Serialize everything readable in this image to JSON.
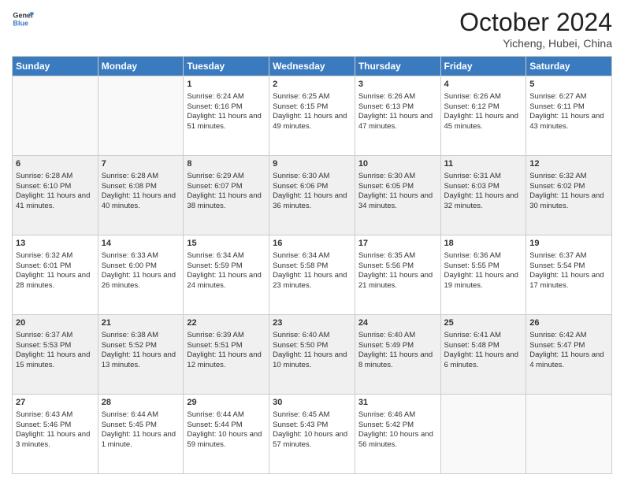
{
  "header": {
    "logo_line1": "General",
    "logo_line2": "Blue",
    "month": "October 2024",
    "location": "Yicheng, Hubei, China"
  },
  "weekdays": [
    "Sunday",
    "Monday",
    "Tuesday",
    "Wednesday",
    "Thursday",
    "Friday",
    "Saturday"
  ],
  "weeks": [
    [
      {
        "day": "",
        "empty": true
      },
      {
        "day": "",
        "empty": true
      },
      {
        "day": "1",
        "sunrise": "Sunrise: 6:24 AM",
        "sunset": "Sunset: 6:16 PM",
        "daylight": "Daylight: 11 hours and 51 minutes."
      },
      {
        "day": "2",
        "sunrise": "Sunrise: 6:25 AM",
        "sunset": "Sunset: 6:15 PM",
        "daylight": "Daylight: 11 hours and 49 minutes."
      },
      {
        "day": "3",
        "sunrise": "Sunrise: 6:26 AM",
        "sunset": "Sunset: 6:13 PM",
        "daylight": "Daylight: 11 hours and 47 minutes."
      },
      {
        "day": "4",
        "sunrise": "Sunrise: 6:26 AM",
        "sunset": "Sunset: 6:12 PM",
        "daylight": "Daylight: 11 hours and 45 minutes."
      },
      {
        "day": "5",
        "sunrise": "Sunrise: 6:27 AM",
        "sunset": "Sunset: 6:11 PM",
        "daylight": "Daylight: 11 hours and 43 minutes."
      }
    ],
    [
      {
        "day": "6",
        "sunrise": "Sunrise: 6:28 AM",
        "sunset": "Sunset: 6:10 PM",
        "daylight": "Daylight: 11 hours and 41 minutes."
      },
      {
        "day": "7",
        "sunrise": "Sunrise: 6:28 AM",
        "sunset": "Sunset: 6:08 PM",
        "daylight": "Daylight: 11 hours and 40 minutes."
      },
      {
        "day": "8",
        "sunrise": "Sunrise: 6:29 AM",
        "sunset": "Sunset: 6:07 PM",
        "daylight": "Daylight: 11 hours and 38 minutes."
      },
      {
        "day": "9",
        "sunrise": "Sunrise: 6:30 AM",
        "sunset": "Sunset: 6:06 PM",
        "daylight": "Daylight: 11 hours and 36 minutes."
      },
      {
        "day": "10",
        "sunrise": "Sunrise: 6:30 AM",
        "sunset": "Sunset: 6:05 PM",
        "daylight": "Daylight: 11 hours and 34 minutes."
      },
      {
        "day": "11",
        "sunrise": "Sunrise: 6:31 AM",
        "sunset": "Sunset: 6:03 PM",
        "daylight": "Daylight: 11 hours and 32 minutes."
      },
      {
        "day": "12",
        "sunrise": "Sunrise: 6:32 AM",
        "sunset": "Sunset: 6:02 PM",
        "daylight": "Daylight: 11 hours and 30 minutes."
      }
    ],
    [
      {
        "day": "13",
        "sunrise": "Sunrise: 6:32 AM",
        "sunset": "Sunset: 6:01 PM",
        "daylight": "Daylight: 11 hours and 28 minutes."
      },
      {
        "day": "14",
        "sunrise": "Sunrise: 6:33 AM",
        "sunset": "Sunset: 6:00 PM",
        "daylight": "Daylight: 11 hours and 26 minutes."
      },
      {
        "day": "15",
        "sunrise": "Sunrise: 6:34 AM",
        "sunset": "Sunset: 5:59 PM",
        "daylight": "Daylight: 11 hours and 24 minutes."
      },
      {
        "day": "16",
        "sunrise": "Sunrise: 6:34 AM",
        "sunset": "Sunset: 5:58 PM",
        "daylight": "Daylight: 11 hours and 23 minutes."
      },
      {
        "day": "17",
        "sunrise": "Sunrise: 6:35 AM",
        "sunset": "Sunset: 5:56 PM",
        "daylight": "Daylight: 11 hours and 21 minutes."
      },
      {
        "day": "18",
        "sunrise": "Sunrise: 6:36 AM",
        "sunset": "Sunset: 5:55 PM",
        "daylight": "Daylight: 11 hours and 19 minutes."
      },
      {
        "day": "19",
        "sunrise": "Sunrise: 6:37 AM",
        "sunset": "Sunset: 5:54 PM",
        "daylight": "Daylight: 11 hours and 17 minutes."
      }
    ],
    [
      {
        "day": "20",
        "sunrise": "Sunrise: 6:37 AM",
        "sunset": "Sunset: 5:53 PM",
        "daylight": "Daylight: 11 hours and 15 minutes."
      },
      {
        "day": "21",
        "sunrise": "Sunrise: 6:38 AM",
        "sunset": "Sunset: 5:52 PM",
        "daylight": "Daylight: 11 hours and 13 minutes."
      },
      {
        "day": "22",
        "sunrise": "Sunrise: 6:39 AM",
        "sunset": "Sunset: 5:51 PM",
        "daylight": "Daylight: 11 hours and 12 minutes."
      },
      {
        "day": "23",
        "sunrise": "Sunrise: 6:40 AM",
        "sunset": "Sunset: 5:50 PM",
        "daylight": "Daylight: 11 hours and 10 minutes."
      },
      {
        "day": "24",
        "sunrise": "Sunrise: 6:40 AM",
        "sunset": "Sunset: 5:49 PM",
        "daylight": "Daylight: 11 hours and 8 minutes."
      },
      {
        "day": "25",
        "sunrise": "Sunrise: 6:41 AM",
        "sunset": "Sunset: 5:48 PM",
        "daylight": "Daylight: 11 hours and 6 minutes."
      },
      {
        "day": "26",
        "sunrise": "Sunrise: 6:42 AM",
        "sunset": "Sunset: 5:47 PM",
        "daylight": "Daylight: 11 hours and 4 minutes."
      }
    ],
    [
      {
        "day": "27",
        "sunrise": "Sunrise: 6:43 AM",
        "sunset": "Sunset: 5:46 PM",
        "daylight": "Daylight: 11 hours and 3 minutes."
      },
      {
        "day": "28",
        "sunrise": "Sunrise: 6:44 AM",
        "sunset": "Sunset: 5:45 PM",
        "daylight": "Daylight: 11 hours and 1 minute."
      },
      {
        "day": "29",
        "sunrise": "Sunrise: 6:44 AM",
        "sunset": "Sunset: 5:44 PM",
        "daylight": "Daylight: 10 hours and 59 minutes."
      },
      {
        "day": "30",
        "sunrise": "Sunrise: 6:45 AM",
        "sunset": "Sunset: 5:43 PM",
        "daylight": "Daylight: 10 hours and 57 minutes."
      },
      {
        "day": "31",
        "sunrise": "Sunrise: 6:46 AM",
        "sunset": "Sunset: 5:42 PM",
        "daylight": "Daylight: 10 hours and 56 minutes."
      },
      {
        "day": "",
        "empty": true
      },
      {
        "day": "",
        "empty": true
      }
    ]
  ],
  "row_styles": [
    "row-white",
    "row-shaded",
    "row-white",
    "row-shaded",
    "row-white"
  ]
}
